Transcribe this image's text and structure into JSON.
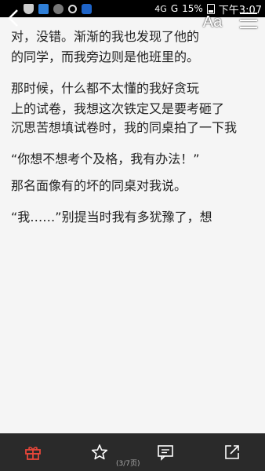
{
  "status_bar": {
    "network": "4G",
    "signal_label": "G",
    "battery_percent": "15%",
    "time": "下午3:07"
  },
  "toolbar": {
    "font_label": "Aa"
  },
  "content": {
    "lines": [
      "    对，没错。渐渐的我也发现了他的",
      "的同学，而我旁边则是他班里的。",
      "",
      "    那时候，什么都不太懂的我好贪玩",
      "上的试卷，我想这次铁定又是要考砸了",
      "沉思苦想填试卷时，我的同桌拍了一下我",
      "",
      "    “你想不想考个及格，我有办法！”",
      "那名面像有的坏的同桌对我说。",
      "",
      "    “我……”别提当时我有多犹豫了，想"
    ]
  },
  "bottom_bar": {
    "page_indicator": "(3/7页)"
  }
}
